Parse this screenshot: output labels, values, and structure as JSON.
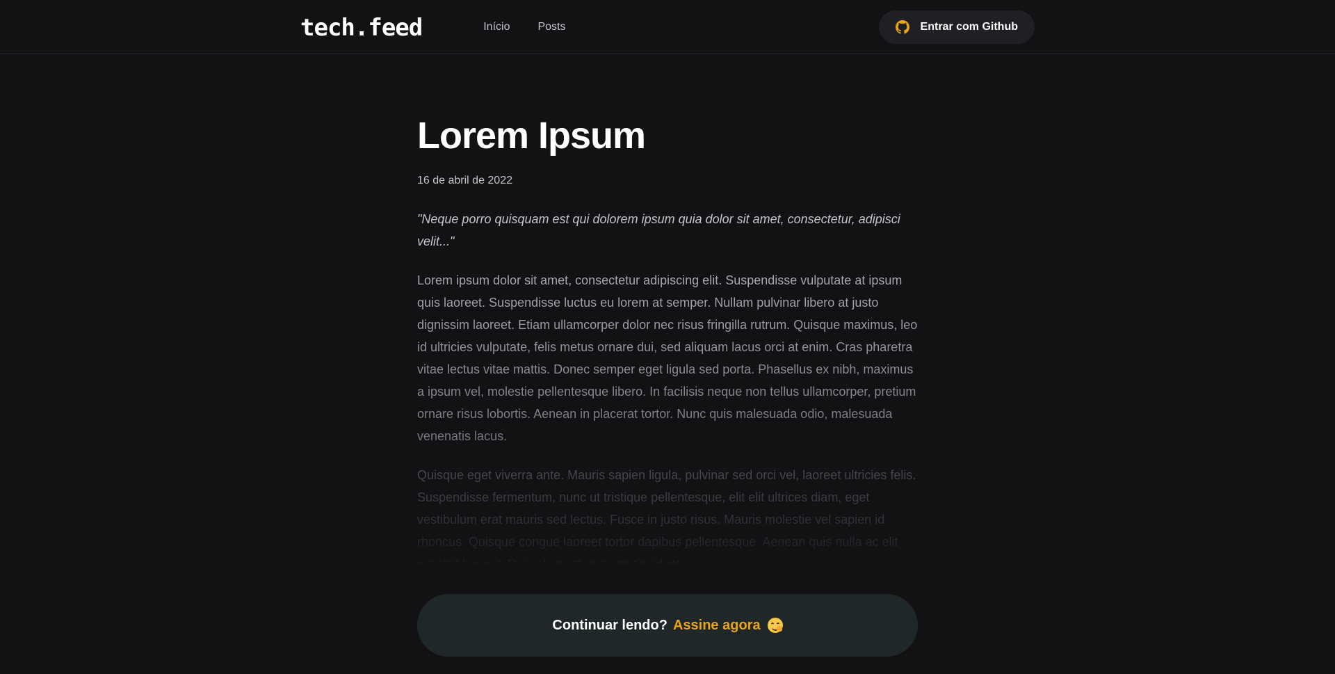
{
  "header": {
    "logo": "tech.feed",
    "nav": [
      {
        "label": "Início"
      },
      {
        "label": "Posts"
      }
    ],
    "login_button": {
      "label": "Entrar com Github",
      "icon": "github-icon",
      "icon_color": "#eba417"
    }
  },
  "post": {
    "title": "Lorem Ipsum",
    "date": "16 de abril de 2022",
    "excerpt": "\"Neque porro quisquam est qui dolorem ipsum quia dolor sit amet, consectetur, adipisci velit...\"",
    "paragraphs": [
      "Lorem ipsum dolor sit amet, consectetur adipiscing elit. Suspendisse vulputate at ipsum quis laoreet. Suspendisse luctus eu lorem at semper. Nullam pulvinar libero at justo dignissim laoreet. Etiam ullamcorper dolor nec risus fringilla rutrum. Quisque maximus, leo id ultricies vulputate, felis metus ornare dui, sed aliquam lacus orci at enim. Cras pharetra vitae lectus vitae mattis. Donec semper eget ligula sed porta. Phasellus ex nibh, maximus a ipsum vel, molestie pellentesque libero. In facilisis neque non tellus ullamcorper, pretium ornare risus lobortis. Aenean in placerat tortor. Nunc quis malesuada odio, malesuada venenatis lacus.",
      "Quisque eget viverra ante. Mauris sapien ligula, pulvinar sed orci vel, laoreet ultricies felis. Suspendisse fermentum, nunc ut tristique pellentesque, elit elit ultrices diam, eget vestibulum erat mauris sed lectus. Fusce in justo risus. Mauris molestie vel sapien id rhoncus. Quisque congue laoreet tortor dapibus pellentesque. Aenean quis nulla ac elit suscipit laoreet. Duis elementum porta tincidunt."
    ]
  },
  "cta": {
    "prompt": "Continuar lendo?",
    "link": "Assine agora",
    "emoji": "hugging-face-emoji"
  },
  "colors": {
    "background": "#121214",
    "accent": "#eba417",
    "cta_background": "#1f2729"
  }
}
